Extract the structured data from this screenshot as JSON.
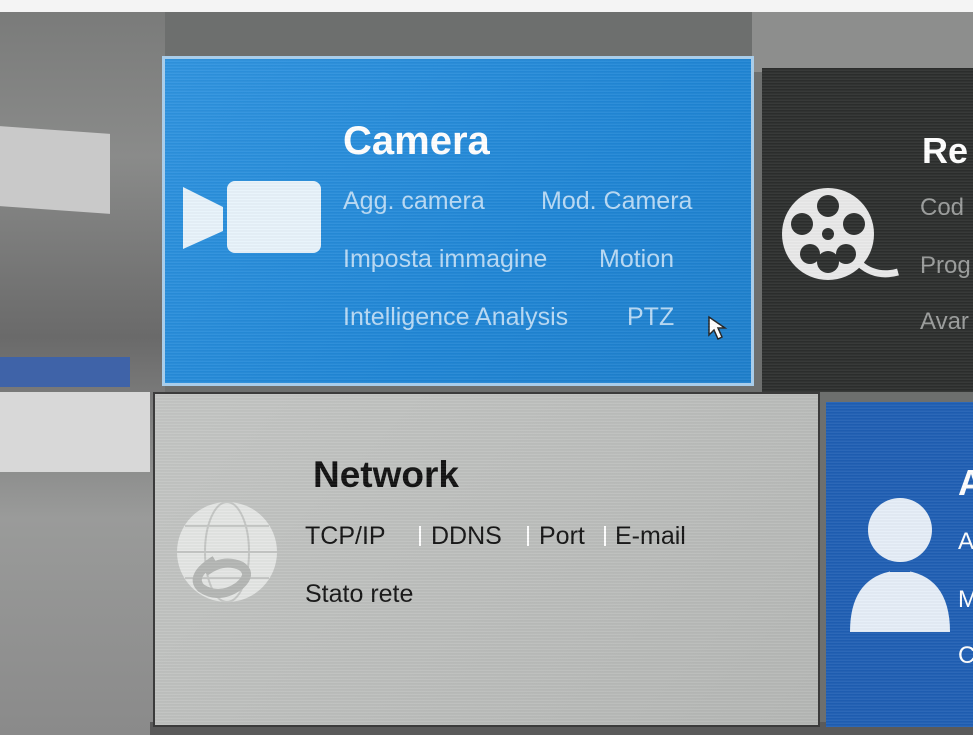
{
  "camera": {
    "title": "Camera",
    "links": [
      "Agg. camera",
      "Mod. Camera",
      "Imposta immagine",
      "Motion",
      "Intelligence Analysis",
      "PTZ"
    ],
    "icon": "video-camera-icon",
    "color": "#1f86d6"
  },
  "record": {
    "title": "Re",
    "links": [
      "Cod",
      "Prog",
      "Avar"
    ],
    "icon": "film-reel-icon"
  },
  "network": {
    "title": "Network",
    "links": [
      "TCP/IP",
      "DDNS",
      "Port",
      "E-mail",
      "Stato rete"
    ],
    "icon": "globe-e-icon"
  },
  "account": {
    "title": "A",
    "links": [
      "A",
      "M",
      "C"
    ],
    "icon": "user-icon",
    "color": "#1f5fb4"
  }
}
